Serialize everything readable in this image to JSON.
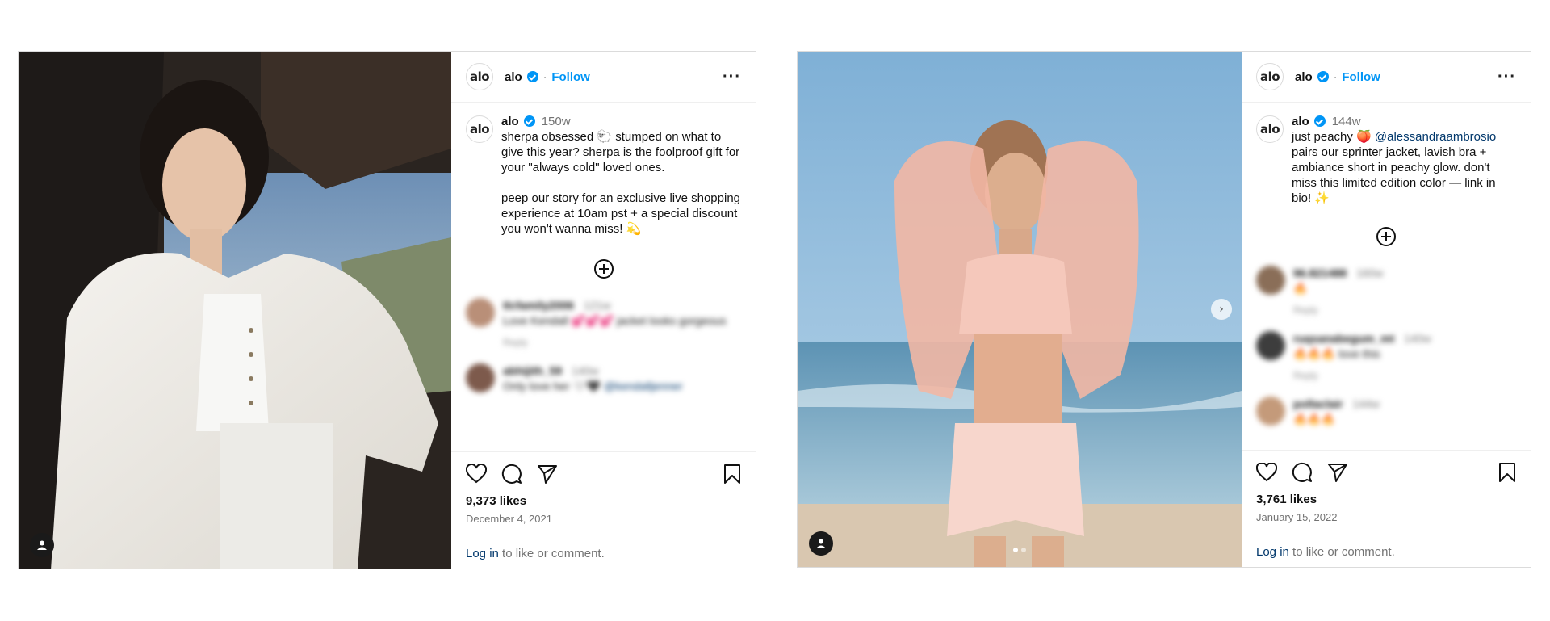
{
  "colors": {
    "accent": "#0095f6",
    "link": "#00376b",
    "muted": "#737373",
    "border": "#dbdbdb"
  },
  "posts": [
    {
      "account": {
        "logo": "alo",
        "name": "alo",
        "follow": "Follow",
        "separator": "·",
        "more": "···"
      },
      "caption": {
        "user": "alo",
        "age": "150w",
        "line1": "sherpa obsessed 🐑 stumped on what to give this year? sherpa is the foolproof gift for your \"always cold\" loved ones.",
        "line2": "peep our story for an exclusive live shopping experience at 10am pst + a special discount you won't wanna miss! 💫"
      },
      "comments": [
        {
          "user": "tlcfamily2006",
          "age": "121w",
          "text": "Love Kendall 💕💕💕 jacket looks gorgeous",
          "reply": "Reply"
        },
        {
          "user": "abhijith_59",
          "age": "140w",
          "text": "Only love her 🤍🖤",
          "mention": "@kendalljenner",
          "reply": "Reply"
        }
      ],
      "likes": "9,373 likes",
      "date": "December 4, 2021",
      "login": {
        "link": "Log in",
        "rest": " to like or comment."
      }
    },
    {
      "account": {
        "logo": "alo",
        "name": "alo",
        "follow": "Follow",
        "separator": "·",
        "more": "···"
      },
      "caption": {
        "user": "alo",
        "age": "144w",
        "prefix": "just peachy 🍑 ",
        "mention": "@alessandraambrosio",
        "rest": " pairs our sprinter jacket, lavish bra + ambiance short in peachy glow. don't miss this limited edition color — link in bio! ✨"
      },
      "comments": [
        {
          "user": "96.821488",
          "age": "160w",
          "text": "🔥",
          "reply": "Reply"
        },
        {
          "user": "ruqsanabegum_mt",
          "age": "140w",
          "text": "🔥🔥🔥 love this",
          "reply": "Reply"
        },
        {
          "user": "pollaclair",
          "age": "144w",
          "text": "🔥🔥🔥",
          "reply": ""
        }
      ],
      "likes": "3,761 likes",
      "date": "January 15, 2022",
      "login": {
        "link": "Log in",
        "rest": " to like or comment."
      }
    }
  ]
}
